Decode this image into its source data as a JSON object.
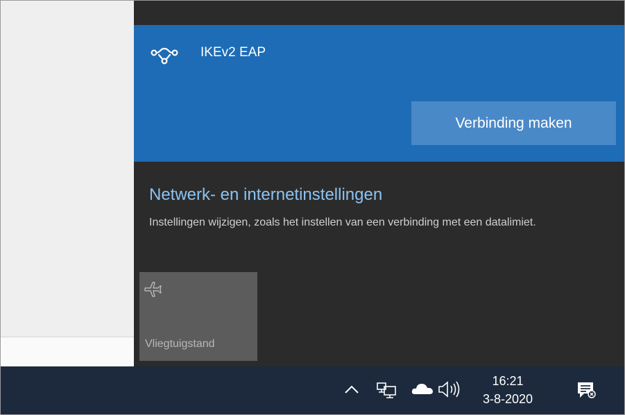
{
  "vpn": {
    "name": "IKEv2 EAP",
    "connect_label": "Verbinding maken",
    "icon": "vpn-icon"
  },
  "settings": {
    "link": "Netwerk- en internetinstellingen",
    "description": "Instellingen wijzigen, zoals het instellen van een verbinding met een datalimiet."
  },
  "quick_actions": [
    {
      "label": "Vliegtuigstand",
      "icon": "airplane-icon"
    }
  ],
  "taskbar": {
    "time": "16:21",
    "date": "3-8-2020",
    "icons": [
      "chevron-up-icon",
      "network-icon",
      "onedrive-cloud-icon",
      "volume-icon",
      "notification-icon"
    ]
  },
  "colors": {
    "accent": "#1e6cb5",
    "button": "#4a89c8",
    "link": "#8cc3f2",
    "flyout_bg": "#2b2b2b",
    "taskbar_bg": "#1d2a3d",
    "tile_bg": "#5c5c5c"
  }
}
